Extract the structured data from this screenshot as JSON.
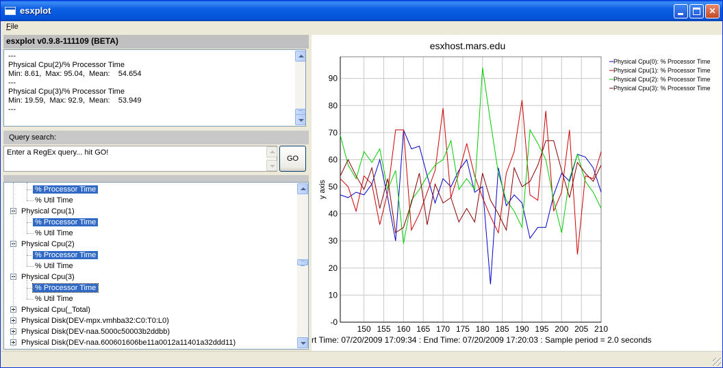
{
  "window": {
    "title": "esxplot"
  },
  "menu": {
    "file_accel": "F",
    "file_rest": "ile"
  },
  "left": {
    "version": "esxplot v0.9.8-111109 (BETA)",
    "stats_lines": [
      "---",
      "Physical Cpu(2)/% Processor Time",
      "Min: 8.61,  Max: 95.04,  Mean:    54.654",
      "---",
      "Physical Cpu(3)/% Processor Time",
      "Min: 19.59,  Max: 92.9,  Mean:    53.949",
      "---"
    ],
    "query_label": "Query search:",
    "query_value": "Enter a RegEx query... hit GO!",
    "go_label": "GO",
    "tree": [
      {
        "level": 2,
        "label": "% Processor Time",
        "selected": true
      },
      {
        "level": 2,
        "label": "% Util Time"
      },
      {
        "level": 1,
        "label": "Physical Cpu(1)",
        "expander": "minus"
      },
      {
        "level": 2,
        "label": "% Processor Time",
        "selected": true
      },
      {
        "level": 2,
        "label": "% Util Time"
      },
      {
        "level": 1,
        "label": "Physical Cpu(2)",
        "expander": "minus"
      },
      {
        "level": 2,
        "label": "% Processor Time",
        "selected": true
      },
      {
        "level": 2,
        "label": "% Util Time"
      },
      {
        "level": 1,
        "label": "Physical Cpu(3)",
        "expander": "minus"
      },
      {
        "level": 2,
        "label": "% Processor Time",
        "selected": true,
        "focus": true
      },
      {
        "level": 2,
        "label": "% Util Time"
      },
      {
        "level": 1,
        "label": "Physical Cpu(_Total)",
        "expander": "plus"
      },
      {
        "level": 1,
        "label": "Physical Disk(DEV-mpx.vmhba32:C0:T0:L0)",
        "expander": "plus"
      },
      {
        "level": 1,
        "label": "Physical Disk(DEV-naa.5000c50003b2ddbb)",
        "expander": "plus"
      },
      {
        "level": 1,
        "label": "Physical Disk(DEV-naa.600601606be11a0012a11401a32ddd11)",
        "expander": "plus"
      }
    ]
  },
  "chart_data": {
    "type": "line",
    "title": "esxhost.mars.edu",
    "ylabel": "y axis",
    "xlim": [
      144,
      210
    ],
    "ylim": [
      0,
      98
    ],
    "x_ticks": [
      150,
      155,
      160,
      165,
      170,
      175,
      180,
      185,
      190,
      195,
      200,
      205,
      210
    ],
    "y_ticks": [
      0,
      10,
      20,
      30,
      40,
      50,
      60,
      70,
      80,
      90
    ],
    "y_tick_labels": [
      "-0",
      "10",
      "20",
      "30",
      "40",
      "50",
      "60",
      "70",
      "80",
      "90"
    ],
    "grid": true,
    "legend_position": "top-right",
    "x": [
      144,
      146,
      148,
      150,
      152,
      154,
      156,
      158,
      160,
      162,
      164,
      166,
      168,
      170,
      172,
      174,
      176,
      178,
      180,
      182,
      184,
      186,
      188,
      190,
      192,
      194,
      196,
      198,
      200,
      202,
      204,
      206,
      208,
      210
    ],
    "series": [
      {
        "name": "Physical Cpu(0): % Processor Time",
        "color": "#0000cc",
        "values": [
          47,
          46,
          48,
          47,
          51,
          60,
          46,
          30,
          71,
          64,
          65,
          54,
          44,
          53,
          50,
          56,
          60,
          48,
          50,
          14,
          57,
          43,
          47,
          44,
          31,
          35,
          35,
          47,
          55,
          52,
          62,
          61,
          57,
          48
        ]
      },
      {
        "name": "Physical Cpu(1): % Processor Time",
        "color": "#cc0000",
        "values": [
          53,
          50,
          41,
          54,
          51,
          36,
          48,
          71,
          71,
          34,
          40,
          48,
          56,
          79,
          46,
          55,
          66,
          54,
          46,
          39,
          33,
          55,
          63,
          82,
          47,
          45,
          78,
          41,
          48,
          71,
          25,
          54,
          53,
          63
        ]
      },
      {
        "name": "Physical Cpu(2): % Processor Time",
        "color": "#00cc00",
        "values": [
          69,
          58,
          53,
          63,
          59,
          64,
          49,
          56,
          29,
          45,
          49,
          54,
          58,
          60,
          67,
          49,
          53,
          49,
          94,
          74,
          55,
          45,
          41,
          35,
          71,
          66,
          60,
          45,
          33,
          53,
          62,
          52,
          48,
          42
        ]
      },
      {
        "name": "Physical Cpu(3): % Processor Time",
        "color": "#880000",
        "values": [
          54,
          60,
          54,
          49,
          57,
          42,
          53,
          33,
          35,
          44,
          55,
          36,
          51,
          44,
          46,
          37,
          42,
          37,
          55,
          45,
          40,
          34,
          57,
          50,
          52,
          58,
          67,
          67,
          56,
          46,
          59,
          55,
          52,
          58
        ]
      }
    ],
    "footer": "rt Time: 07/20/2009 17:09:34   :   End Time: 07/20/2009 17:20:03  : Sample period = 2.0 seconds"
  }
}
